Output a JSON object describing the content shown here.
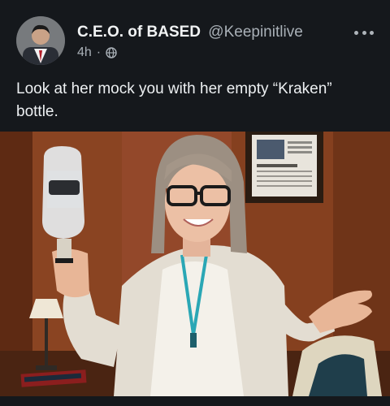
{
  "post": {
    "display_name": "C.E.O. of BASED",
    "handle": "@Keepinitlive",
    "time_ago": "4h",
    "separator": "·",
    "text": "Look at her mock you with her empty “Kraken” bottle.",
    "icons": {
      "visibility": "globe-icon",
      "menu": "more-options-icon"
    },
    "colors": {
      "background": "#15181c",
      "text": "#e7e9ea",
      "muted": "#a9b0b7"
    }
  }
}
